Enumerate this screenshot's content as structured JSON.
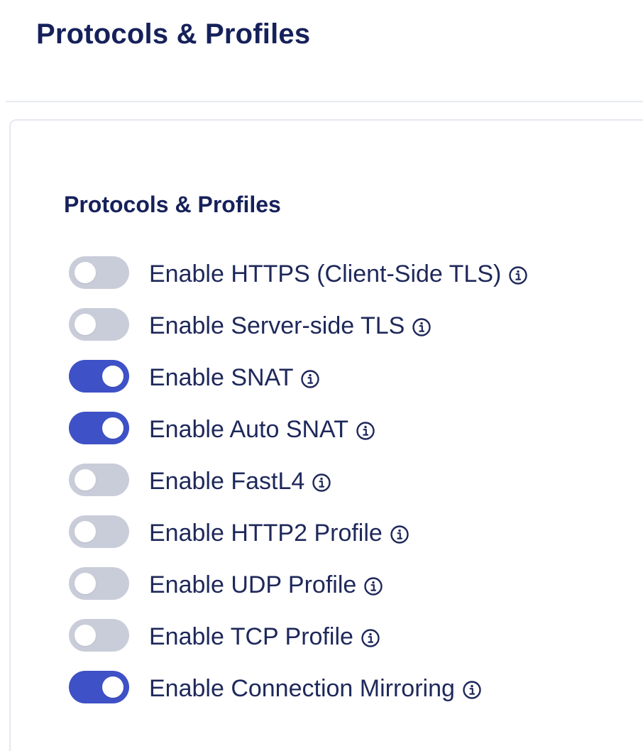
{
  "header": {
    "title": "Protocols & Profiles"
  },
  "card": {
    "section_title": "Protocols & Profiles",
    "toggles": [
      {
        "label": "Enable HTTPS (Client-Side TLS)",
        "enabled": false,
        "icon": "info-icon"
      },
      {
        "label": "Enable Server-side TLS",
        "enabled": false,
        "icon": "info-icon"
      },
      {
        "label": "Enable SNAT",
        "enabled": true,
        "icon": "info-icon"
      },
      {
        "label": "Enable Auto SNAT",
        "enabled": true,
        "icon": "info-icon"
      },
      {
        "label": "Enable FastL4",
        "enabled": false,
        "icon": "info-icon"
      },
      {
        "label": "Enable HTTP2 Profile",
        "enabled": false,
        "icon": "info-icon"
      },
      {
        "label": "Enable UDP Profile",
        "enabled": false,
        "icon": "info-icon"
      },
      {
        "label": "Enable TCP Profile",
        "enabled": false,
        "icon": "info-icon"
      },
      {
        "label": "Enable Connection Mirroring",
        "enabled": true,
        "icon": "info-icon"
      }
    ]
  },
  "colors": {
    "toggle_on": "#3f51c6",
    "toggle_off": "#c9cdd9",
    "heading": "#16215a",
    "text": "#1e285a"
  }
}
